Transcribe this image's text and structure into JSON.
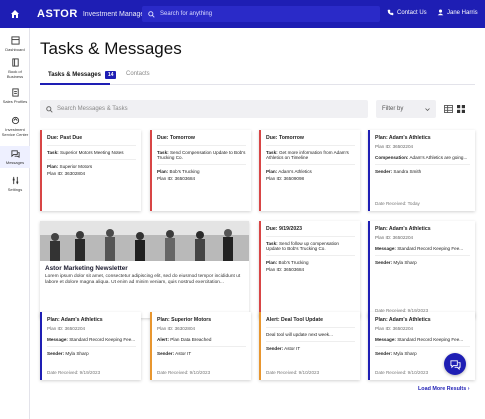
{
  "topbar": {
    "brand": "ASTOR",
    "brand_sub": "Investment Management",
    "search_placeholder": "Search for anything",
    "contact_label": "Contact Us",
    "user_name": "Jane Harris"
  },
  "sidebar": {
    "items": [
      {
        "label": "Dashboard",
        "icon": "dashboard-icon"
      },
      {
        "label": "Book of Business",
        "icon": "book-icon"
      },
      {
        "label": "Sales Profiles",
        "icon": "sales-profile-icon"
      },
      {
        "label": "Investment Service Center",
        "icon": "service-center-icon"
      },
      {
        "label": "Messages",
        "icon": "messages-icon"
      },
      {
        "label": "Settings",
        "icon": "settings-icon"
      }
    ]
  },
  "page": {
    "title": "Tasks & Messages",
    "tabs": [
      {
        "label": "Tasks & Messages",
        "badge": "14"
      },
      {
        "label": "Contacts"
      }
    ],
    "search_placeholder": "Search Messages & Tasks",
    "filter_label": "Filter by"
  },
  "cards": [
    {
      "heading": "Due: Past Due",
      "sub": "",
      "lines": [
        {
          "label": "Task:",
          "text": "Superior Motors Meeting Notes"
        },
        {
          "label": "",
          "text": ""
        },
        {
          "label": "Plan:",
          "text": "Superior Motors"
        },
        {
          "label": "",
          "text": "Plan ID: 36302804"
        }
      ],
      "foot": ""
    },
    {
      "heading": "Due: Tomorrow",
      "sub": "",
      "lines": [
        {
          "label": "Task:",
          "text": "Send Compensation Update to Bob's Trucking Co."
        },
        {
          "label": "",
          "text": ""
        },
        {
          "label": "Plan:",
          "text": "Bob's Trucking"
        },
        {
          "label": "",
          "text": "Plan ID: 36503684"
        }
      ],
      "foot": ""
    },
    {
      "heading": "Due: Tomorrow",
      "sub": "",
      "lines": [
        {
          "label": "Task:",
          "text": "Get more information from Adam's Athletics on Timeline"
        },
        {
          "label": "",
          "text": ""
        },
        {
          "label": "Plan:",
          "text": "Adam's Athletics"
        },
        {
          "label": "",
          "text": "Plan ID: 36509098"
        }
      ],
      "foot": ""
    },
    {
      "heading": "Plan: Adam's Athletics",
      "sub": "Plan ID: 36502204",
      "lines": [
        {
          "label": "Compensation:",
          "text": "Adam's Athletics are going..."
        },
        {
          "label": "Sender:",
          "text": "Sandra Smith"
        }
      ],
      "foot": "Date Received: Today"
    },
    {
      "heading": "Due: 9/19/2023",
      "sub": "",
      "lines": [
        {
          "label": "Task:",
          "text": "Send follow up compensation Update to Bob's Trucking Co."
        },
        {
          "label": "",
          "text": ""
        },
        {
          "label": "Plan:",
          "text": "Bob's Trucking"
        },
        {
          "label": "",
          "text": "Plan ID: 36503684"
        }
      ],
      "foot": ""
    },
    {
      "heading": "Plan: Adam's Athletics",
      "sub": "Plan ID: 36502204",
      "lines": [
        {
          "label": "Message:",
          "text": "Standard Record Keeping Fee..."
        },
        {
          "label": "Sender:",
          "text": "Myla Sharp"
        }
      ],
      "foot": "Date Received: 9/19/2023"
    },
    {
      "heading": "Plan: Adam's Athletics",
      "sub": "Plan ID: 36502204",
      "lines": [
        {
          "label": "Message:",
          "text": "Standard Record Keeping Fee..."
        },
        {
          "label": "Sender:",
          "text": "Myla Sharp"
        }
      ],
      "foot": "Date Received: 9/19/2023"
    },
    {
      "heading": "Plan: Superior Motors",
      "sub": "Plan ID: 36302804",
      "lines": [
        {
          "label": "Alert:",
          "text": "Plan Data Breached"
        },
        {
          "label": "Sender:",
          "text": "Astor IT"
        }
      ],
      "foot": "Date Received: 9/10/2023"
    },
    {
      "heading": "Alert: Deal Tool Update",
      "sub": "",
      "lines": [
        {
          "label": "",
          "text": "Deal tool will update next week..."
        },
        {
          "label": "Sender:",
          "text": "Astor IT"
        }
      ],
      "foot": "Date Received: 9/10/2023"
    },
    {
      "heading": "Plan: Adam's Athletics",
      "sub": "Plan ID: 36502204",
      "lines": [
        {
          "label": "Message:",
          "text": "Standard Record Keeping Fee..."
        },
        {
          "label": "Sender:",
          "text": "Myla Sharp"
        }
      ],
      "foot": "Date Received: 9/10/2023"
    }
  ],
  "newsletter": {
    "title": "Astor Marketing Newsletter",
    "body": "Lorem ipsum dolor sit amet, consectetur adipiscing elit, sed do eiusmod tempor incididunt ut labore et dolore magna aliqua. Ut enim ad minim veniam, quis nostrud exercitation..."
  },
  "load_more_label": "Load More Results",
  "colors": {
    "primary": "#1e1eb4",
    "accent_red": "#d84545",
    "accent_orange": "#e8962f"
  }
}
